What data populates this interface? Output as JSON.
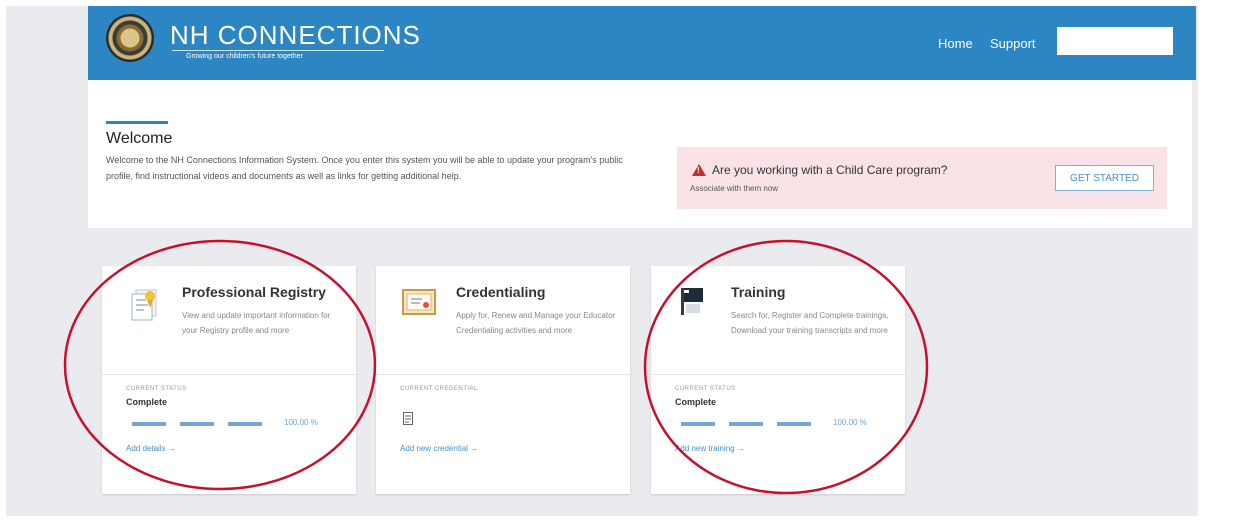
{
  "header": {
    "logo_text": "NH CONNECTIONS",
    "tagline": "Growing our children's future together",
    "nav": {
      "home": "Home",
      "support": "Support"
    },
    "search_value": ""
  },
  "welcome": {
    "title": "Welcome",
    "text": "Welcome to the NH Connections Information System. Once you enter this system you will be able to update your program's public profile, find instructional videos and documents as well as links for getting additional help."
  },
  "alert": {
    "title": "Are you working with a Child Care program?",
    "subtitle": "Associate with them now",
    "button": "GET STARTED"
  },
  "cards": [
    {
      "title": "Professional Registry",
      "description": "View and update important information for your Registry profile and more",
      "status_label": "CURRENT STATUS",
      "status": "Complete",
      "progress_percent": 100,
      "progress_text": "100.00 %",
      "link": "Add details →"
    },
    {
      "title": "Credentialing",
      "description": "Apply for, Renew and Manage your Educator Credentialing activities and more",
      "status_label": "CURRENT CREDENTIAL",
      "link": "Add new credential →"
    },
    {
      "title": "Training",
      "description": "Search for, Register and Complete trainings, Download your training transcripts and more",
      "status_label": "CURRENT STATUS",
      "status": "Complete",
      "progress_percent": 100,
      "progress_text": "100.00 %",
      "link": "Add new training →"
    }
  ],
  "colors": {
    "header_blue": "#2d86c4",
    "alert_bg": "#fae3e6",
    "alert_icon": "#c62d2d",
    "progress": "#6fa8d6",
    "annotation_circle": "#c8102e"
  },
  "icons": {
    "seal": "state-seal-icon",
    "alert": "warning-triangle-icon",
    "registry": "certificate-document-icon",
    "credentialing": "diploma-icon",
    "training": "flag-icon",
    "credential_item": "document-icon"
  }
}
